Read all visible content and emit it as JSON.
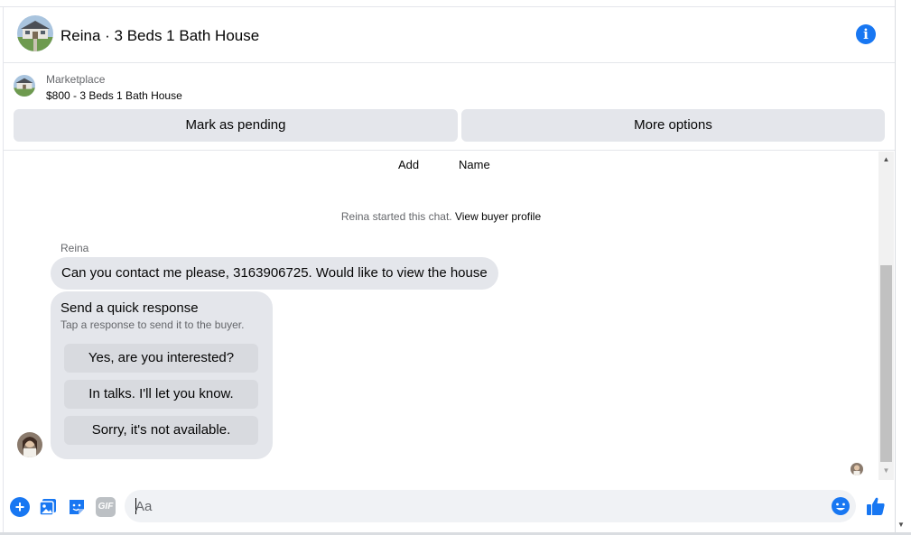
{
  "header": {
    "title": "Reina · 3 Beds 1 Bath House"
  },
  "marketplace": {
    "label": "Marketplace",
    "item": "$800 - 3 Beds 1 Bath House",
    "buttons": {
      "pending": "Mark as pending",
      "more": "More options"
    }
  },
  "chat": {
    "add_label": "Add",
    "name_label": "Name",
    "started_text": "Reina started this chat.",
    "started_link": "View buyer profile",
    "sender": "Reina",
    "message": "Can you contact me please, 3163906725.  Would like to view the house",
    "quick": {
      "title": "Send a quick response",
      "subtitle": "Tap a response to send it to the buyer.",
      "options": [
        "Yes, are you interested?",
        "In talks. I'll let you know.",
        "Sorry, it's not available."
      ]
    }
  },
  "composer": {
    "placeholder": "Aa",
    "gif_label": "GIF"
  },
  "colors": {
    "accent": "#1877f2",
    "bubble": "#e4e6eb",
    "muted_text": "#65676b"
  },
  "icons": [
    "info-icon",
    "plus-icon",
    "photo-icon",
    "sticker-icon",
    "gif-icon",
    "emoji-icon",
    "like-icon"
  ]
}
